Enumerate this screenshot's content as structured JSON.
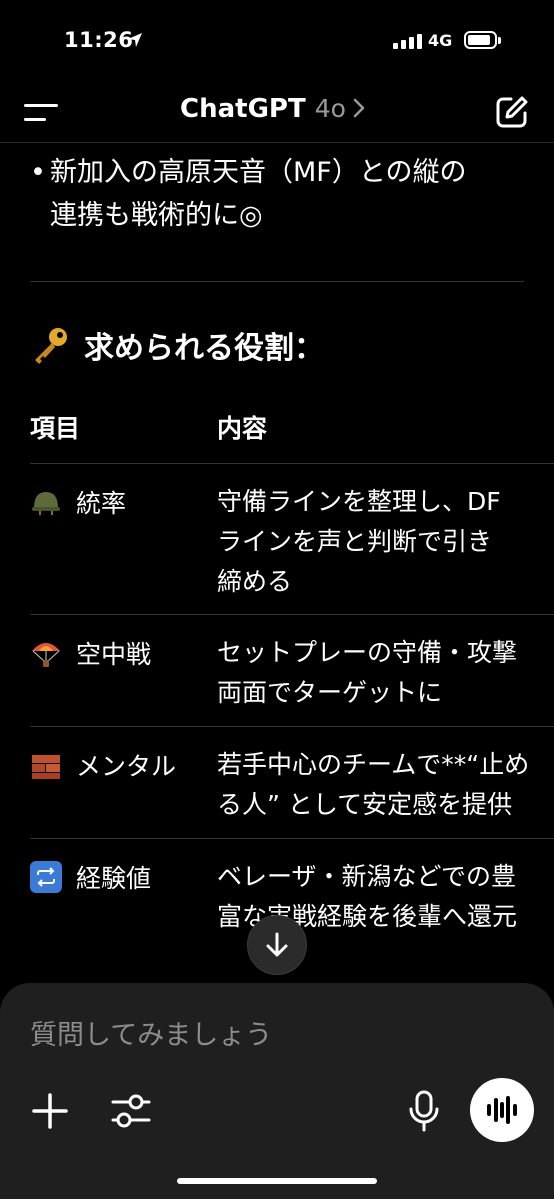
{
  "status_bar": {
    "time": "11:26",
    "network": "4G",
    "battery_icon": "battery-icon",
    "signal_icon": "cellular-signal-icon"
  },
  "header": {
    "title": "ChatGPT",
    "model": "4o"
  },
  "content": {
    "bullet": {
      "line1": "新加入の高原天音（MF）との縦の",
      "line2": "連携も戦術的に◎"
    },
    "section_title": "求められる役割：",
    "table": {
      "headers": [
        "項目",
        "内容"
      ],
      "rows": [
        {
          "icon": "military-helmet-icon",
          "item": "統率",
          "lines": [
            "守備ラインを整理し、DF",
            "ラインを声と判断で引き",
            "締める"
          ]
        },
        {
          "icon": "parachute-icon",
          "item": "空中戦",
          "lines": [
            "セットプレーの守備・攻撃",
            "両面でターゲットに"
          ]
        },
        {
          "icon": "brick-icon",
          "item": "メンタル",
          "lines": [
            "若手中心のチームで**“止め",
            "る人” として安定感を提供"
          ]
        },
        {
          "icon": "repeat-icon",
          "item": "経験値",
          "lines": [
            "ベレーザ・新潟などでの豊",
            "富な実戦経験を後輩へ還元"
          ]
        }
      ]
    }
  },
  "composer": {
    "placeholder": "質問してみましょう"
  },
  "colors": {
    "background": "#000000",
    "composer_bg": "#1f1f1f",
    "muted_text": "#8c8c8c",
    "divider": "#333333"
  }
}
